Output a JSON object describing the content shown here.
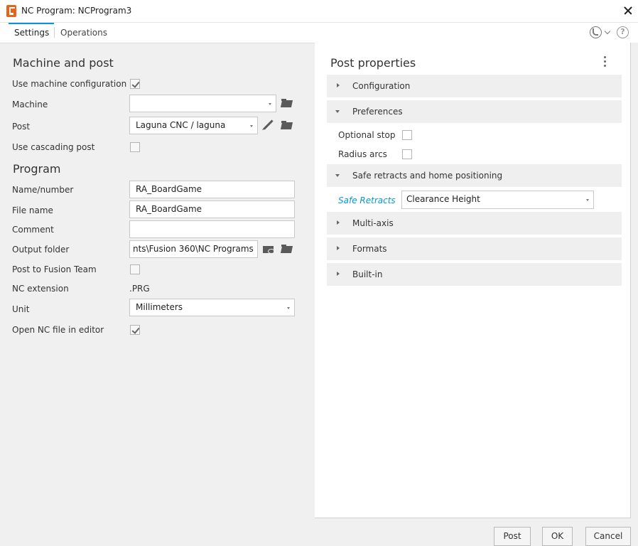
{
  "window": {
    "title": "NC Program: NCProgram3"
  },
  "tabs": {
    "settings": "Settings",
    "operations": "Operations"
  },
  "left": {
    "machine_section": "Machine and post",
    "use_machine_config": {
      "label": "Use machine configuration",
      "checked": true
    },
    "machine": {
      "label": "Machine",
      "value": ""
    },
    "post": {
      "label": "Post",
      "value": "Laguna CNC / laguna"
    },
    "use_cascading_post": {
      "label": "Use cascading post",
      "checked": false
    },
    "program_section": "Program",
    "name_number": {
      "label": "Name/number",
      "value": "RA_BoardGame"
    },
    "file_name": {
      "label": "File name",
      "value": "RA_BoardGame"
    },
    "comment": {
      "label": "Comment",
      "value": ""
    },
    "output_folder": {
      "label": "Output folder",
      "value": "nts\\Fusion 360\\NC Programs"
    },
    "post_to_team": {
      "label": "Post to Fusion Team",
      "checked": false
    },
    "nc_extension": {
      "label": "NC extension",
      "value": ".PRG"
    },
    "unit": {
      "label": "Unit",
      "value": "Millimeters"
    },
    "open_in_editor": {
      "label": "Open NC file in editor",
      "checked": true
    }
  },
  "right": {
    "title": "Post properties",
    "groups": {
      "configuration": "Configuration",
      "preferences": "Preferences",
      "safe_retracts_group": "Safe retracts and home positioning",
      "multi_axis": "Multi-axis",
      "formats": "Formats",
      "built_in": "Built-in"
    },
    "optional_stop": {
      "label": "Optional stop",
      "checked": false
    },
    "radius_arcs": {
      "label": "Radius arcs",
      "checked": false
    },
    "safe_retracts": {
      "label": "Safe Retracts",
      "value": "Clearance Height"
    }
  },
  "buttons": {
    "post": "Post",
    "ok": "OK",
    "cancel": "Cancel"
  },
  "colors": {
    "accent": "#0696d7",
    "link_label": "#0696d7"
  },
  "icons": [
    "app-icon",
    "close-icon",
    "phone-icon",
    "chevron-down-icon",
    "help-icon",
    "folder-icon",
    "pencil-icon",
    "folder-eye-icon",
    "kebab-menu-icon"
  ]
}
